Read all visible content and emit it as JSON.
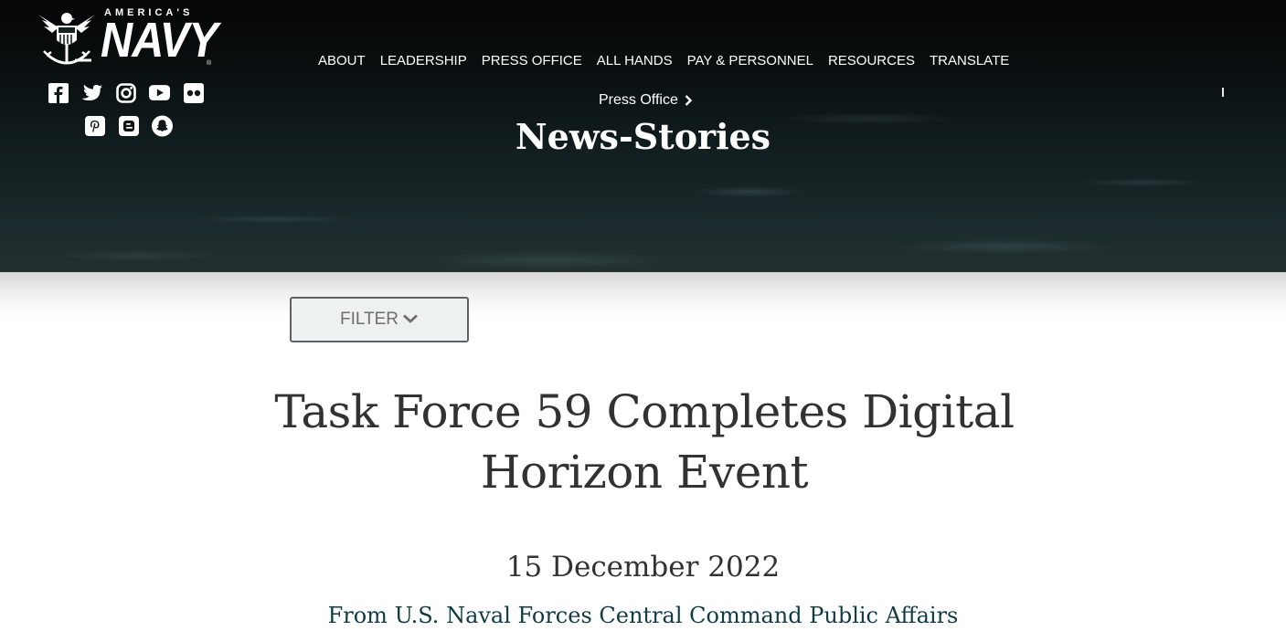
{
  "brand": {
    "top_line": "AMERICA'S",
    "wordmark": "NAVY",
    "registered": "®"
  },
  "social": [
    {
      "name": "facebook-icon"
    },
    {
      "name": "twitter-icon"
    },
    {
      "name": "instagram-icon"
    },
    {
      "name": "youtube-icon"
    },
    {
      "name": "flickr-icon"
    },
    {
      "name": "pinterest-icon"
    },
    {
      "name": "blogger-icon"
    },
    {
      "name": "snapchat-icon"
    }
  ],
  "nav": {
    "items": [
      {
        "label": "ABOUT"
      },
      {
        "label": "LEADERSHIP"
      },
      {
        "label": "PRESS OFFICE"
      },
      {
        "label": "ALL HANDS"
      },
      {
        "label": "PAY & PERSONNEL"
      },
      {
        "label": "RESOURCES"
      },
      {
        "label": "TRANSLATE"
      }
    ]
  },
  "breadcrumb": {
    "parent": "Press Office"
  },
  "page": {
    "title": "News-Stories"
  },
  "filter": {
    "label": "FILTER"
  },
  "article": {
    "headline": "Task Force 59 Completes Digital Horizon Event",
    "date": "15 December 2022",
    "source": "From U.S. Naval Forces Central Command Public Affairs"
  },
  "colors": {
    "hero_dark": "#0b1112",
    "title_text": "#323232",
    "source_text": "#0f3b44",
    "filter_border": "#5f6163"
  }
}
